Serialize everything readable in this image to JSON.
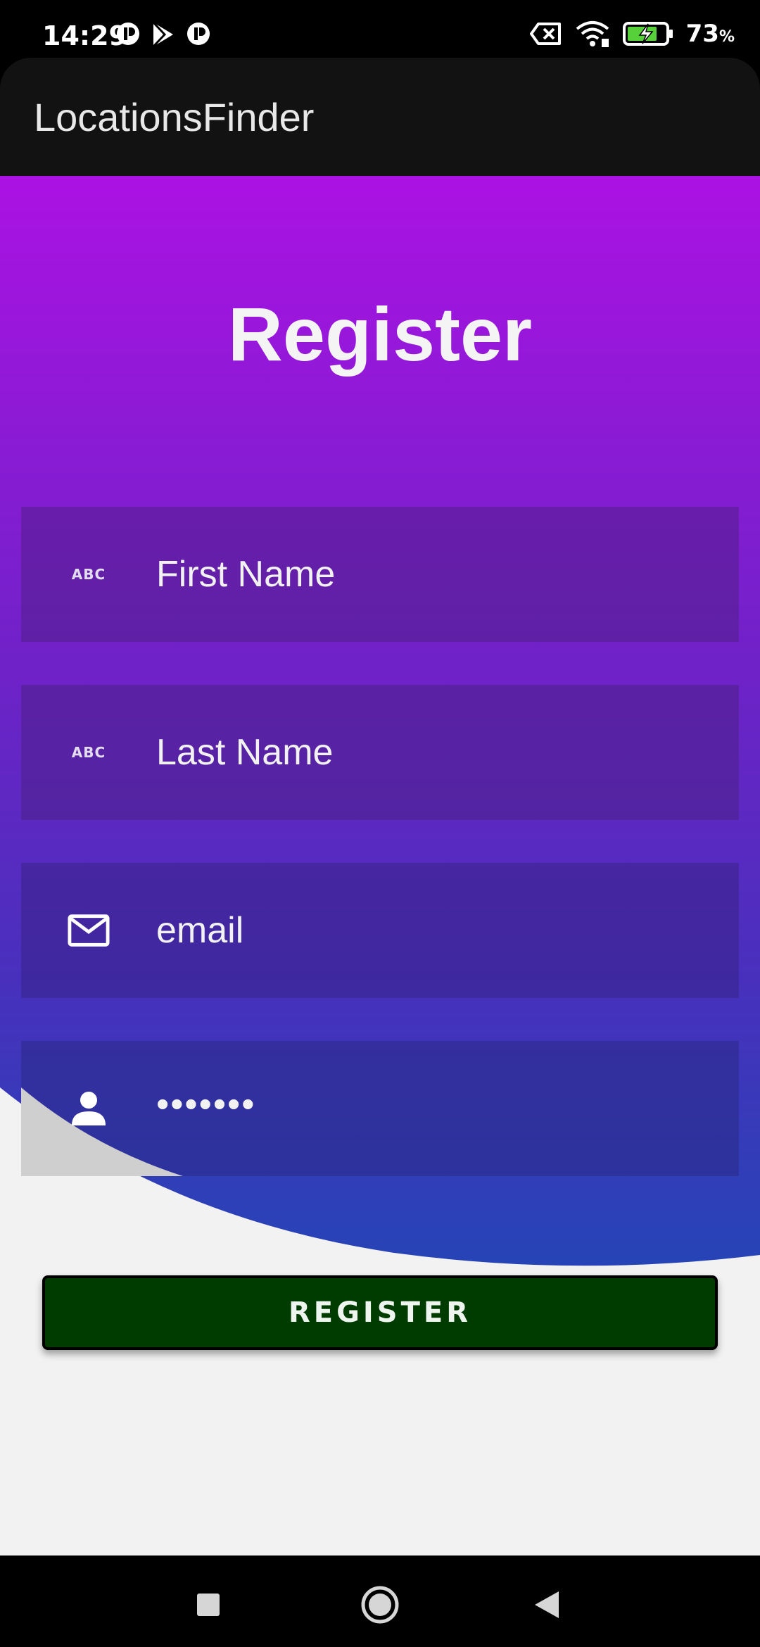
{
  "status_bar": {
    "time": "14:29",
    "battery_percent": "73",
    "battery_unit": "%",
    "battery_level": 0.73,
    "icons": [
      "notification-icon",
      "play-store-icon",
      "notification-icon",
      "data-off-icon",
      "wifi-icon",
      "battery-charging-icon"
    ]
  },
  "app_bar": {
    "title": "LocationsFinder"
  },
  "form": {
    "title": "Register",
    "fields": [
      {
        "icon": "abc-icon",
        "placeholder": "First Name"
      },
      {
        "icon": "abc-icon",
        "placeholder": "Last Name"
      },
      {
        "icon": "mail-icon",
        "placeholder": "email"
      },
      {
        "icon": "person-icon",
        "value": "•••••••"
      }
    ],
    "register_label": "REGISTER"
  },
  "nav_bar": {
    "icons": [
      "recents-square-icon",
      "home-circle-icon",
      "back-triangle-icon"
    ]
  },
  "colors": {
    "gradient_top": "#ab12e3",
    "gradient_bottom": "#2644b6",
    "button_bg": "#003c00",
    "page_bg": "#f2f2f2"
  }
}
